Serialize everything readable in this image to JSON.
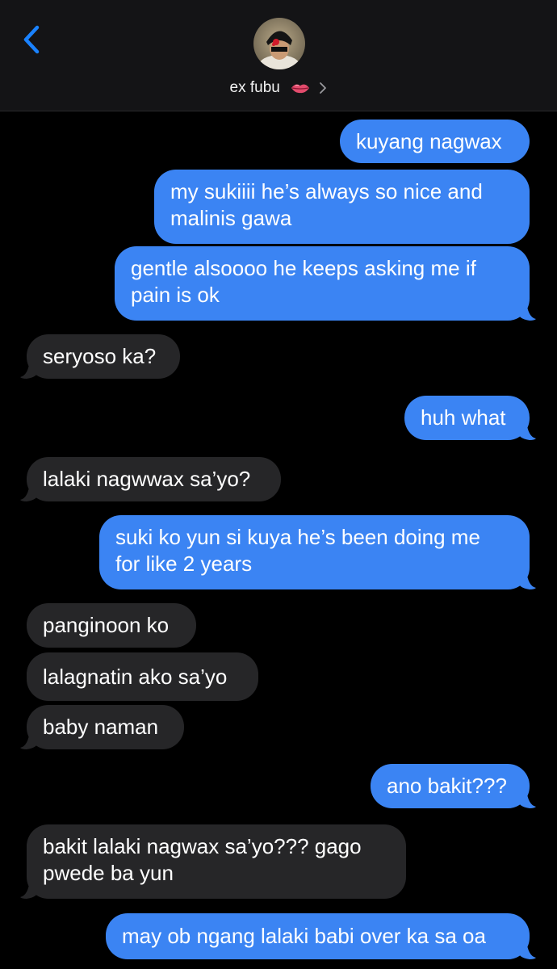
{
  "header": {
    "contact_name": "ex fubu",
    "contact_emoji_icon": "kiss-mark-lips-icon",
    "back_icon": "chevron-left-icon",
    "info_icon": "chevron-right-icon"
  },
  "colors": {
    "outgoing_bubble": "#3b84f3",
    "incoming_bubble": "#262628",
    "accent_blue": "#1a82ff",
    "background": "#000000"
  },
  "messages": [
    {
      "direction": "out",
      "lines": [
        "kuyang nagwax"
      ]
    },
    {
      "direction": "out",
      "lines": [
        "my sukiiii he’s always so nice and",
        "malinis gawa"
      ]
    },
    {
      "direction": "out",
      "lines": [
        "gentle alsoooo he keeps asking me if",
        "pain is ok"
      ]
    },
    {
      "direction": "in",
      "lines": [
        "seryoso ka?"
      ]
    },
    {
      "direction": "out",
      "lines": [
        "huh what"
      ]
    },
    {
      "direction": "in",
      "lines": [
        "lalaki nagwwax sa’yo?"
      ]
    },
    {
      "direction": "out",
      "lines": [
        "suki ko yun si kuya he’s been doing me",
        "for like 2 years"
      ]
    },
    {
      "direction": "in",
      "lines": [
        "panginoon ko"
      ]
    },
    {
      "direction": "in",
      "lines": [
        "lalagnatin ako sa’yo"
      ]
    },
    {
      "direction": "in",
      "lines": [
        "baby naman"
      ]
    },
    {
      "direction": "out",
      "lines": [
        "ano bakit???"
      ]
    },
    {
      "direction": "in",
      "lines": [
        "bakit lalaki nagwax sa’yo??? gago",
        "pwede ba yun"
      ]
    },
    {
      "direction": "out",
      "lines": [
        "may ob ngang lalaki babi over ka sa oa"
      ]
    }
  ]
}
